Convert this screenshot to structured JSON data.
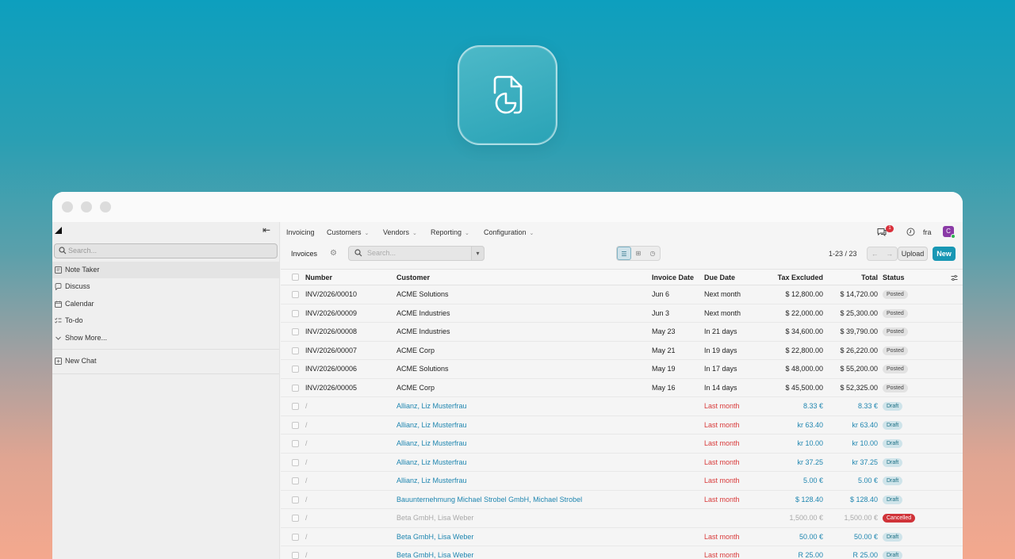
{
  "sidebar": {
    "search_placeholder": "Search...",
    "items": [
      {
        "label": "Note Taker",
        "icon": "note-icon"
      },
      {
        "label": "Discuss",
        "icon": "chat-bubble-icon"
      },
      {
        "label": "Calendar",
        "icon": "calendar-icon"
      },
      {
        "label": "To-do",
        "icon": "checklist-icon"
      },
      {
        "label": "Show More...",
        "icon": "chevron-down-icon"
      }
    ],
    "new_chat": "New Chat"
  },
  "topbar": {
    "menu": [
      "Invoicing",
      "Customers",
      "Vendors",
      "Reporting",
      "Configuration"
    ],
    "notification_count": "1",
    "company_short": "fra",
    "avatar_letter": "C"
  },
  "control_panel": {
    "title": "Invoices",
    "search_placeholder": "Search...",
    "pager": "1-23 / 23",
    "upload_label": "Upload",
    "new_label": "New"
  },
  "table": {
    "headers": {
      "number": "Number",
      "customer": "Customer",
      "invoice_date": "Invoice Date",
      "due_date": "Due Date",
      "tax_excluded": "Tax Excluded",
      "total": "Total",
      "status": "Status"
    },
    "rows": [
      {
        "number": "INV/2026/00010",
        "customer": "ACME Solutions",
        "invoice_date": "Jun 6",
        "due_date": "Next month",
        "tax_excluded": "$ 12,800.00",
        "total": "$ 14,720.00",
        "status": "Posted",
        "kind": "posted"
      },
      {
        "number": "INV/2026/00009",
        "customer": "ACME Industries",
        "invoice_date": "Jun 3",
        "due_date": "Next month",
        "tax_excluded": "$ 22,000.00",
        "total": "$ 25,300.00",
        "status": "Posted",
        "kind": "posted"
      },
      {
        "number": "INV/2026/00008",
        "customer": "ACME Industries",
        "invoice_date": "May 23",
        "due_date": "In 21 days",
        "tax_excluded": "$ 34,600.00",
        "total": "$ 39,790.00",
        "status": "Posted",
        "kind": "posted"
      },
      {
        "number": "INV/2026/00007",
        "customer": "ACME Corp",
        "invoice_date": "May 21",
        "due_date": "In 19 days",
        "tax_excluded": "$ 22,800.00",
        "total": "$ 26,220.00",
        "status": "Posted",
        "kind": "posted"
      },
      {
        "number": "INV/2026/00006",
        "customer": "ACME Solutions",
        "invoice_date": "May 19",
        "due_date": "In 17 days",
        "tax_excluded": "$ 48,000.00",
        "total": "$ 55,200.00",
        "status": "Posted",
        "kind": "posted"
      },
      {
        "number": "INV/2026/00005",
        "customer": "ACME Corp",
        "invoice_date": "May 16",
        "due_date": "In 14 days",
        "tax_excluded": "$ 45,500.00",
        "total": "$ 52,325.00",
        "status": "Posted",
        "kind": "posted"
      },
      {
        "number": "/",
        "customer": "Allianz, Liz Musterfrau",
        "invoice_date": "",
        "due_date": "Last month",
        "tax_excluded": "8.33 €",
        "total": "8.33 €",
        "status": "Draft",
        "kind": "draft"
      },
      {
        "number": "/",
        "customer": "Allianz, Liz Musterfrau",
        "invoice_date": "",
        "due_date": "Last month",
        "tax_excluded": "kr 63.40",
        "total": "kr 63.40",
        "status": "Draft",
        "kind": "draft"
      },
      {
        "number": "/",
        "customer": "Allianz, Liz Musterfrau",
        "invoice_date": "",
        "due_date": "Last month",
        "tax_excluded": "kr 10.00",
        "total": "kr 10.00",
        "status": "Draft",
        "kind": "draft"
      },
      {
        "number": "/",
        "customer": "Allianz, Liz Musterfrau",
        "invoice_date": "",
        "due_date": "Last month",
        "tax_excluded": "kr 37.25",
        "total": "kr 37.25",
        "status": "Draft",
        "kind": "draft"
      },
      {
        "number": "/",
        "customer": "Allianz, Liz Musterfrau",
        "invoice_date": "",
        "due_date": "Last month",
        "tax_excluded": "5.00 €",
        "total": "5.00 €",
        "status": "Draft",
        "kind": "draft"
      },
      {
        "number": "/",
        "customer": "Bauunternehmung Michael Strobel GmbH, Michael Strobel",
        "invoice_date": "",
        "due_date": "Last month",
        "tax_excluded": "$ 128.40",
        "total": "$ 128.40",
        "status": "Draft",
        "kind": "draft"
      },
      {
        "number": "/",
        "customer": "Beta GmbH, Lisa Weber",
        "invoice_date": "",
        "due_date": "",
        "tax_excluded": "1,500.00 €",
        "total": "1,500.00 €",
        "status": "Cancelled",
        "kind": "cancelled"
      },
      {
        "number": "/",
        "customer": "Beta GmbH, Lisa Weber",
        "invoice_date": "",
        "due_date": "Last month",
        "tax_excluded": "50.00 €",
        "total": "50.00 €",
        "status": "Draft",
        "kind": "draft"
      },
      {
        "number": "/",
        "customer": "Beta GmbH, Lisa Weber",
        "invoice_date": "",
        "due_date": "Last month",
        "tax_excluded": "R 25.00",
        "total": "R 25.00",
        "status": "Draft",
        "kind": "draft"
      }
    ]
  },
  "colors": {
    "accent": "#1897b4",
    "link": "#1f86b0",
    "overdue": "#d83a3a",
    "cancelled": "#d03339"
  }
}
